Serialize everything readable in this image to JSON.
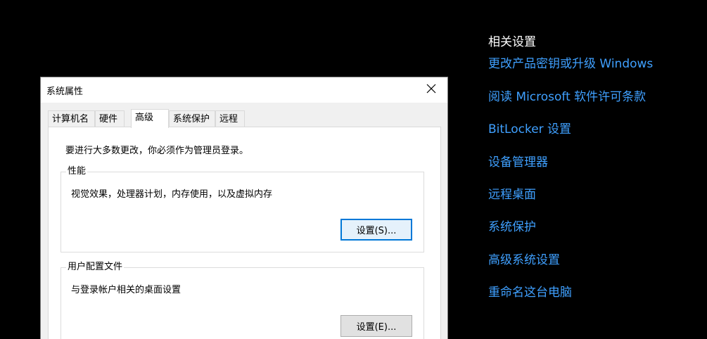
{
  "related_settings": {
    "title": "相关设置",
    "links": [
      {
        "label": "更改产品密钥或升级 Windows"
      },
      {
        "label": "阅读 Microsoft 软件许可条款"
      },
      {
        "label": "BitLocker 设置"
      },
      {
        "label": "设备管理器"
      },
      {
        "label": "远程桌面"
      },
      {
        "label": "系统保护"
      },
      {
        "label": "高级系统设置"
      },
      {
        "label": "重命名这台电脑"
      }
    ]
  },
  "dialog": {
    "title": "系统属性",
    "close_icon": "close-icon",
    "tabs": [
      {
        "label": "计算机名",
        "active": false
      },
      {
        "label": "硬件",
        "active": false
      },
      {
        "label": "高级",
        "active": true
      },
      {
        "label": "系统保护",
        "active": false
      },
      {
        "label": "远程",
        "active": false
      }
    ],
    "notice": "要进行大多数更改，你必须作为管理员登录。",
    "performance": {
      "legend": "性能",
      "description": "视觉效果，处理器计划，内存使用，以及虚拟内存",
      "button_label": "设置(S)..."
    },
    "user_profiles": {
      "legend": "用户配置文件",
      "description": "与登录帐户相关的桌面设置",
      "button_label": "设置(E)..."
    }
  },
  "colors": {
    "background": "#000000",
    "link": "#3fa0ff",
    "focus": "#0078d7"
  }
}
